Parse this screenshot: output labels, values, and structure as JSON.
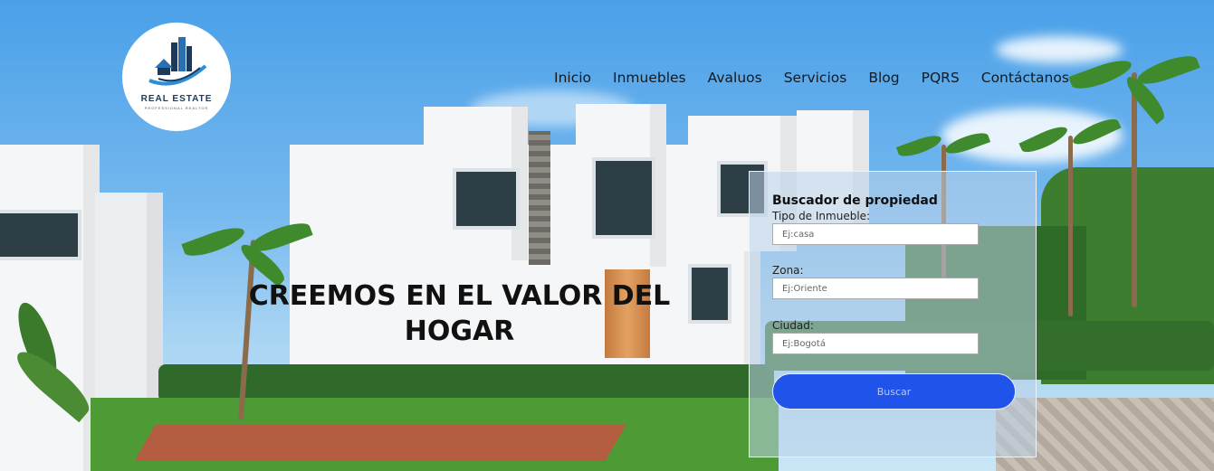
{
  "brand": {
    "name": "REAL ESTATE",
    "tagline": "PROFESSIONAL REALTOR",
    "colors": {
      "primary": "#1c3a5c",
      "accent": "#2a8fd6"
    }
  },
  "nav": {
    "items": [
      {
        "label": "Inicio"
      },
      {
        "label": "Inmuebles"
      },
      {
        "label": "Avaluos"
      },
      {
        "label": "Servicios"
      },
      {
        "label": "Blog"
      },
      {
        "label": "PQRS"
      },
      {
        "label": "Contáctanos"
      }
    ]
  },
  "hero": {
    "headline_line1": "CREEMOS EN EL VALOR DEL",
    "headline_line2": "HOGAR"
  },
  "search": {
    "title": "Buscador de propiedad",
    "fields": [
      {
        "label": "Tipo de Inmueble:",
        "placeholder": "Ej:casa"
      },
      {
        "label": "Zona:",
        "placeholder": "Ej:Oriente"
      },
      {
        "label": "Ciudad:",
        "placeholder": "Ej:Bogotá"
      }
    ],
    "button_label": "Buscar",
    "button_color": "#1f53e9"
  }
}
